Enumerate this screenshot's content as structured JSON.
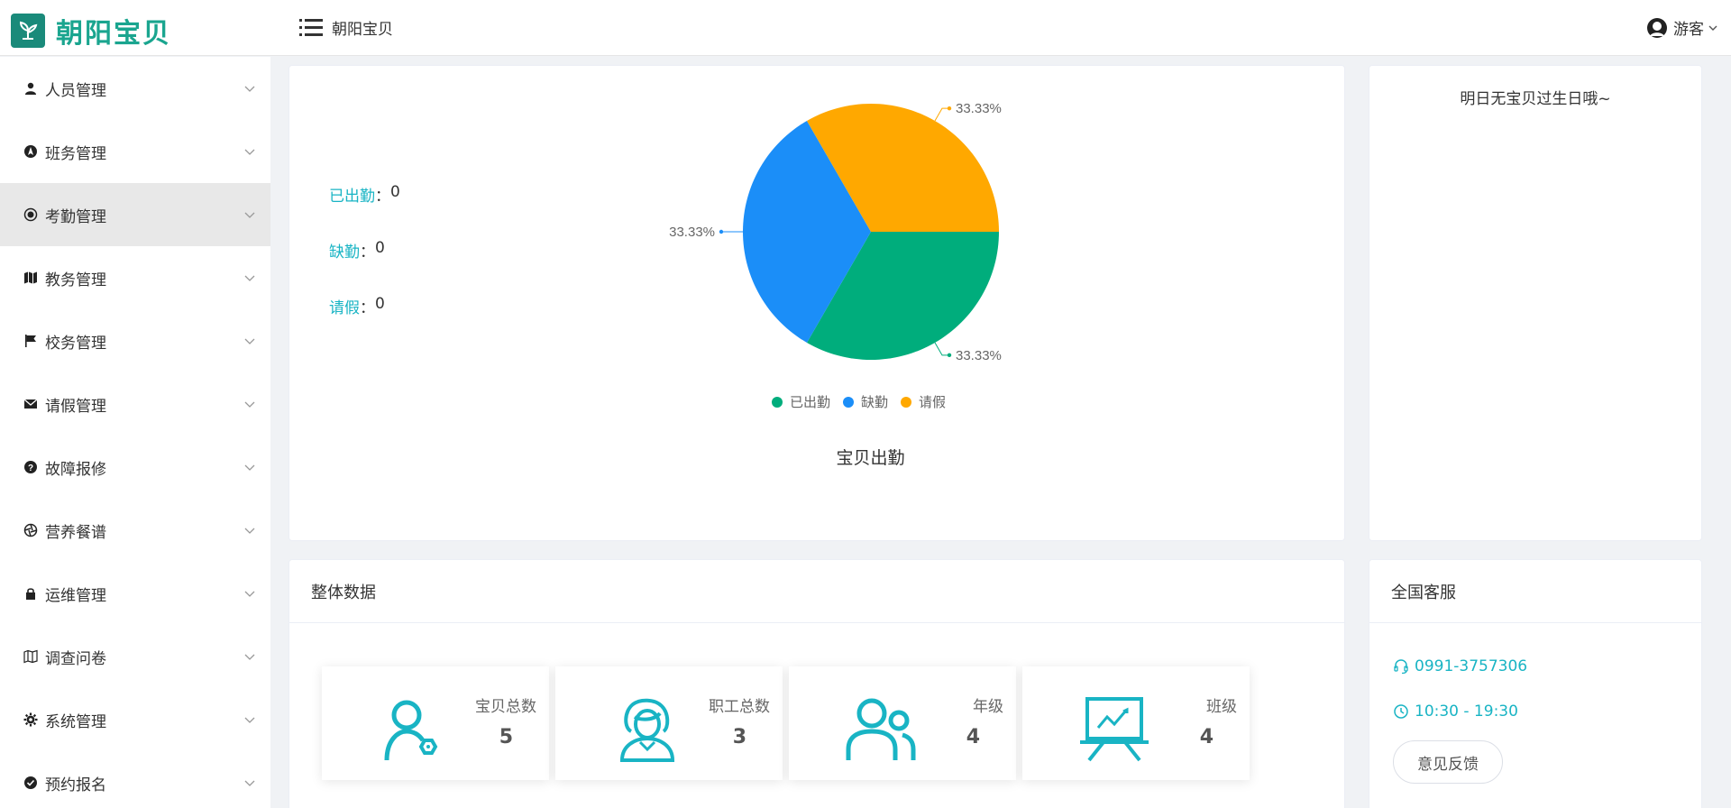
{
  "header": {
    "logo_text": "朝阳宝贝",
    "breadcrumb": "朝阳宝贝",
    "user_name": "游客"
  },
  "sidebar": {
    "items": [
      {
        "label": "人员管理",
        "icon": "user-icon"
      },
      {
        "label": "班务管理",
        "icon": "compass-icon"
      },
      {
        "label": "考勤管理",
        "icon": "record-icon",
        "active": true
      },
      {
        "label": "教务管理",
        "icon": "map-icon"
      },
      {
        "label": "校务管理",
        "icon": "flag-icon"
      },
      {
        "label": "请假管理",
        "icon": "mail-icon"
      },
      {
        "label": "故障报修",
        "icon": "question-icon"
      },
      {
        "label": "营养餐谱",
        "icon": "aperture-icon"
      },
      {
        "label": "运维管理",
        "icon": "lock-icon"
      },
      {
        "label": "调查问卷",
        "icon": "map-outline-icon"
      },
      {
        "label": "系统管理",
        "icon": "gear-icon"
      },
      {
        "label": "预约报名",
        "icon": "check-circle-icon"
      }
    ]
  },
  "attendance": {
    "present_label": "已出勤",
    "present_value": "0",
    "absent_label": "缺勤",
    "absent_value": "0",
    "leave_label": "请假",
    "leave_value": "0",
    "separator": "："
  },
  "chart_data": {
    "type": "pie",
    "title": "宝贝出勤",
    "slices": [
      {
        "name": "已出勤",
        "value": 33.33,
        "label": "33.33%",
        "color": "#00ad7c"
      },
      {
        "name": "缺勤",
        "value": 33.33,
        "label": "33.33%",
        "color": "#1b8ef8"
      },
      {
        "name": "请假",
        "value": 33.33,
        "label": "33.33%",
        "color": "#ffa800"
      }
    ],
    "legend_position": "bottom"
  },
  "birthday": {
    "text": "明日无宝贝过生日哦~"
  },
  "overall": {
    "title": "整体数据",
    "stats": [
      {
        "label": "宝贝总数",
        "value": "5",
        "icon": "child-icon"
      },
      {
        "label": "职工总数",
        "icon": "staff-icon",
        "value": "3"
      },
      {
        "label": "年级",
        "value": "4",
        "icon": "group-icon"
      },
      {
        "label": "班级",
        "value": "4",
        "icon": "classroom-icon"
      }
    ]
  },
  "service": {
    "title": "全国客服",
    "phone": "0991-3757306",
    "hours": "10:30 - 19:30",
    "feedback_label": "意见反馈"
  },
  "colors": {
    "accent": "#19b4c4",
    "brand": "#1aa58f",
    "present": "#00ad7c",
    "absent": "#1b8ef8",
    "leave": "#ffa800"
  }
}
